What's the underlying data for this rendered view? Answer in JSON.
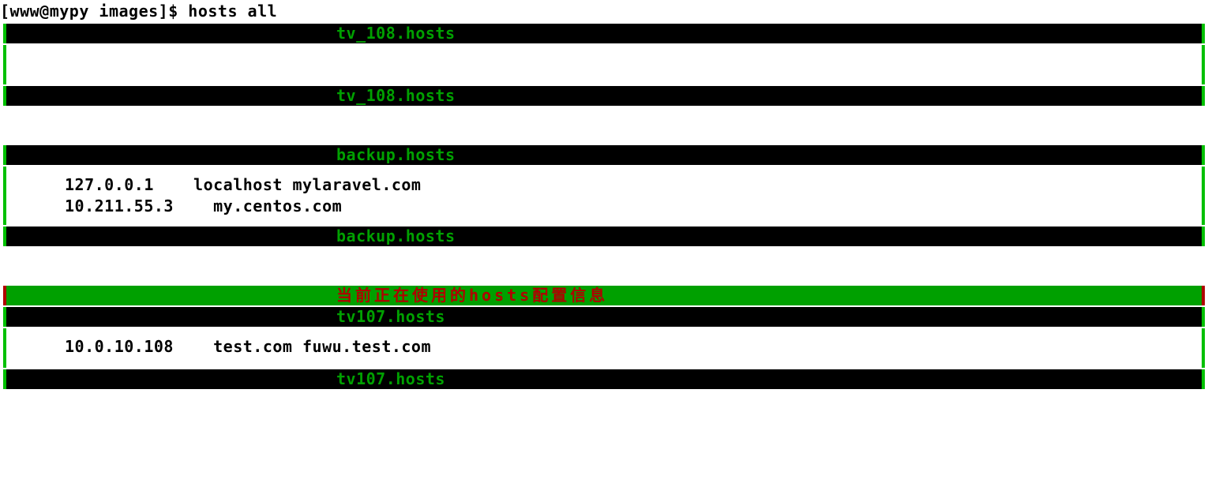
{
  "prompt": "[www@mypy images]$ hosts all",
  "sections": [
    {
      "header": "tv_108.hosts",
      "footer": "tv_108.hosts",
      "highlight": null,
      "lines": []
    },
    {
      "header": "backup.hosts",
      "footer": "backup.hosts",
      "highlight": null,
      "lines": [
        "127.0.0.1    localhost mylaravel.com",
        "10.211.55.3    my.centos.com"
      ]
    },
    {
      "header": "tv107.hosts",
      "footer": "tv107.hosts",
      "highlight": "当前正在使用的hosts配置信息",
      "lines": [
        "10.0.10.108    test.com fuwu.test.com"
      ]
    }
  ]
}
